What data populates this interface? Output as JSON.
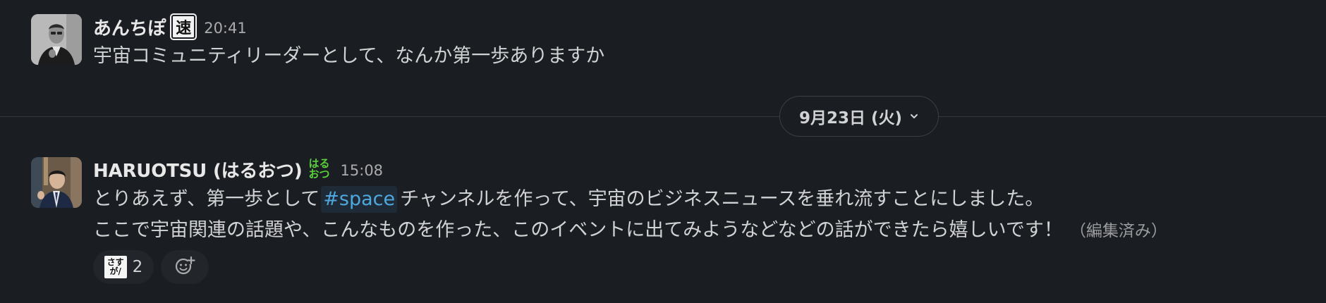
{
  "messages": [
    {
      "sender": "あんちぽ",
      "status_emoji": "速",
      "time": "20:41",
      "text": "宇宙コミュニティリーダーとして、なんか第一歩ありますか"
    },
    {
      "sender": "HARUOTSU (はるおつ)",
      "status_emoji_top": "はる",
      "status_emoji_bottom": "おつ",
      "time": "15:08",
      "line1_before": "とりあえず、第一歩として",
      "channel": "#space",
      "line1_after": "チャンネルを作って、宇宙のビジネスニュースを垂れ流すことにしました。",
      "line2": "ここで宇宙関連の話題や、こんなものを作った、このイベントに出てみようなどなどの話ができたら嬉しいです！",
      "edited": "（編集済み）",
      "reactions": [
        {
          "emoji_top": "さす",
          "emoji_bottom": "が/",
          "count": "2"
        }
      ]
    }
  ],
  "date_divider": {
    "label": "9月23日 (火)"
  },
  "icons": {
    "date_chevron": "chevron-down-icon",
    "add_reaction": "add-reaction-icon"
  },
  "colors": {
    "background": "#1a1d21",
    "channel_link": "#4ea8de",
    "haruotsu_emoji": "#5ad03a"
  }
}
